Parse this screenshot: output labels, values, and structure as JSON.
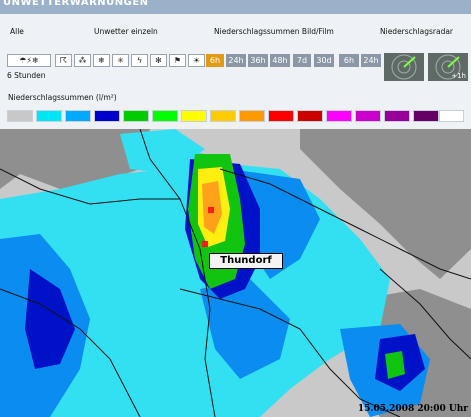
{
  "header": {
    "title": "UNWETTERWARNUNGEN"
  },
  "toolbar": {
    "alle_label": "Alle",
    "unwetter_label": "Unwetter einzeln",
    "niederschlag_label": "Niederschlagssummen Bild/Film",
    "radar_label": "Niederschlagsradar",
    "stunden_label": "6 Stunden",
    "warning_icons": [
      "multi-weather-icon",
      "storm-icon",
      "hail-icon",
      "snow-icon",
      "frost-icon",
      "thunder-icon",
      "ice-icon",
      "wind-icon",
      "sun-icon"
    ],
    "time_buttons": [
      "6h",
      "24h",
      "36h",
      "48h",
      "7d",
      "30d",
      "6h",
      "24h"
    ],
    "active_time_button": 0,
    "radar_tag": "+1h"
  },
  "legend": {
    "title": "Niederschlagssummen (l/m²)",
    "colors": [
      "#c8c8c8",
      "#00e6f5",
      "#00aaff",
      "#0000cc",
      "#00cc00",
      "#00ff00",
      "#ffff00",
      "#ffcc00",
      "#ff9900",
      "#ff0000",
      "#cc0000",
      "#ff00ff",
      "#cc00cc",
      "#990099",
      "#660066",
      "#ffffff"
    ]
  },
  "map": {
    "place_label": "Thundorf",
    "timestamp": "15.05.2008 20:00 Uhr"
  }
}
